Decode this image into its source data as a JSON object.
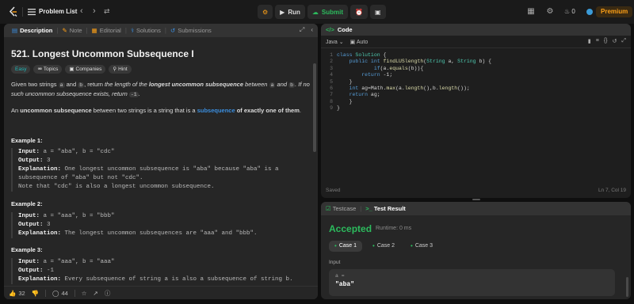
{
  "nav": {
    "problem_list": "Problem List",
    "run": "Run",
    "submit": "Submit",
    "streak": "0",
    "premium": "Premium"
  },
  "tabs": {
    "description": "Description",
    "note": "Note",
    "editorial": "Editorial",
    "solutions": "Solutions",
    "submissions": "Submissions"
  },
  "problem": {
    "title": "521. Longest Uncommon Subsequence I",
    "difficulty": "Easy",
    "topics": "Topics",
    "companies": "Companies",
    "hint": "Hint",
    "desc1_a": "Given two strings ",
    "var_a": "a",
    "desc1_and": " and ",
    "var_b": "b",
    "desc1_b": ", return ",
    "desc1_em": "the length of the ",
    "desc1_strong": "longest uncommon subsequence",
    "desc1_c": " between ",
    "desc1_d": " and ",
    "desc1_e": ". If no such uncommon subsequence exists, return ",
    "neg_one": "-1",
    "desc1_f": ".",
    "desc2_a": "An ",
    "desc2_strong": "uncommon subsequence",
    "desc2_b": " between two strings is a string that is a ",
    "desc2_link": "subsequence",
    "desc2_c": " of exactly one of them",
    "desc2_d": "."
  },
  "examples": [
    {
      "title": "Example 1:",
      "input_label": "Input:",
      "input": " a = \"aba\", b = \"cdc\"",
      "output_label": "Output:",
      "output": " 3",
      "expl_label": "Explanation:",
      "expl": " One longest uncommon subsequence is \"aba\" because \"aba\" is a",
      "expl2": "subsequence of \"aba\" but not \"cdc\".",
      "expl3": "Note that \"cdc\" is also a longest uncommon subsequence."
    },
    {
      "title": "Example 2:",
      "input_label": "Input:",
      "input": " a = \"aaa\", b = \"bbb\"",
      "output_label": "Output:",
      "output": " 3",
      "expl_label": "Explanation:",
      "expl": " The longest uncommon subsequences are \"aaa\" and \"bbb\"."
    },
    {
      "title": "Example 3:",
      "input_label": "Input:",
      "input": " a = \"aaa\", b = \"aaa\"",
      "output_label": "Output:",
      "output": " -1",
      "expl_label": "Explanation:",
      "expl": " Every subsequence of string a is also a subsequence of string b."
    }
  ],
  "footer": {
    "likes": "32",
    "comments": "44"
  },
  "code": {
    "header": "Code",
    "language": "Java",
    "auto": "Auto",
    "status": "Saved",
    "position": "Ln 7, Col 19",
    "lines": [
      {
        "n": "1"
      },
      {
        "n": "2"
      },
      {
        "n": "3"
      },
      {
        "n": "4"
      },
      {
        "n": "5"
      },
      {
        "n": "6"
      },
      {
        "n": "7"
      },
      {
        "n": "8"
      },
      {
        "n": "9"
      }
    ],
    "l1": [
      "class",
      " ",
      "Solution",
      " {"
    ],
    "l2": [
      "    ",
      "public",
      " ",
      "int",
      " ",
      "findLUSlength",
      "(",
      "String",
      " a, ",
      "String",
      " b) {"
    ],
    "l3": [
      "            ",
      "if",
      "(a.",
      "equals",
      "(b)){"
    ],
    "l4": [
      "        ",
      "return",
      " -1;"
    ],
    "l5": "    }",
    "l6": [
      "    ",
      "int",
      " ag=Math.",
      "max",
      "(a.",
      "length",
      "(),b.",
      "length",
      "());"
    ],
    "l7": [
      "    ",
      "return",
      " ag;"
    ],
    "l8": "    }",
    "l9": "}"
  },
  "test": {
    "testcase": "Testcase",
    "result": "Test Result",
    "accepted": "Accepted",
    "runtime": "Runtime: 0 ms",
    "cases": [
      "Case 1",
      "Case 2",
      "Case 3"
    ],
    "input_label": "Input",
    "var_name": "a =",
    "var_value": "\"aba\""
  },
  "colors": {
    "accent_green": "#2cbb5d",
    "premium_orange": "#ffa116",
    "easy_teal": "#1cbaba",
    "link_blue": "#3b8fe0"
  }
}
